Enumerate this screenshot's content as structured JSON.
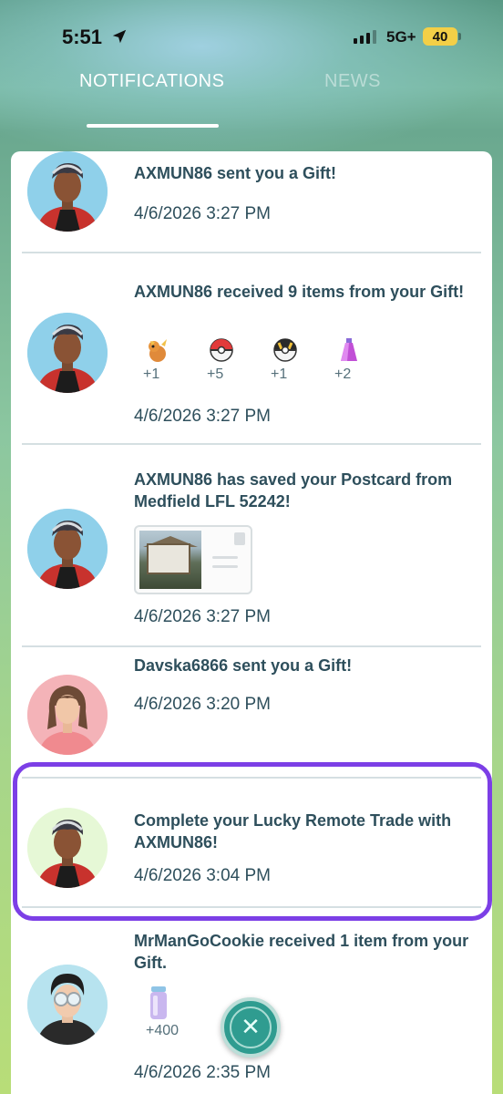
{
  "status_bar": {
    "time": "5:51",
    "network": "5G+",
    "battery": "40",
    "location_icon": "location-arrow-icon",
    "signal_icon": "signal-bars-icon"
  },
  "tabs": [
    {
      "label": "NOTIFICATIONS",
      "active": true
    },
    {
      "label": "NEWS",
      "active": false
    }
  ],
  "notifications": [
    {
      "message": "AXMUN86 sent you a Gift!",
      "timestamp": "4/6/2026 3:27 PM",
      "avatar": "avatar-male-red-jacket"
    },
    {
      "message": "AXMUN86 received 9 items from your Gift!",
      "timestamp": "4/6/2026 3:27 PM",
      "avatar": "avatar-male-red-jacket",
      "items": [
        {
          "icon": "pokemon-sprite-icon",
          "count": "+1"
        },
        {
          "icon": "poke-ball-icon",
          "count": "+5"
        },
        {
          "icon": "ultra-ball-icon",
          "count": "+1"
        },
        {
          "icon": "potion-icon",
          "count": "+2"
        }
      ]
    },
    {
      "message": "AXMUN86 has saved your Postcard from Medfield LFL 52242!",
      "timestamp": "4/6/2026 3:27 PM",
      "avatar": "avatar-male-red-jacket"
    },
    {
      "message": "Davska6866 sent you a Gift!",
      "timestamp": "4/6/2026 3:20 PM",
      "avatar": "avatar-female-brown-hair"
    },
    {
      "message": "Complete your Lucky Remote Trade with AXMUN86!",
      "timestamp": "4/6/2026 3:04 PM",
      "avatar": "avatar-male-red-jacket",
      "highlighted": true
    },
    {
      "message": "MrManGoCookie received 1 item from your Gift.",
      "timestamp": "4/6/2026 2:35 PM",
      "avatar": "avatar-male-goggles",
      "items": [
        {
          "icon": "incense-canister-icon",
          "count": "+400"
        }
      ]
    }
  ],
  "close_button": {
    "icon": "close-icon"
  },
  "colors": {
    "highlight_border": "#7c3fe6",
    "text": "#2e4f5c",
    "close_button": "#2f9c90"
  }
}
